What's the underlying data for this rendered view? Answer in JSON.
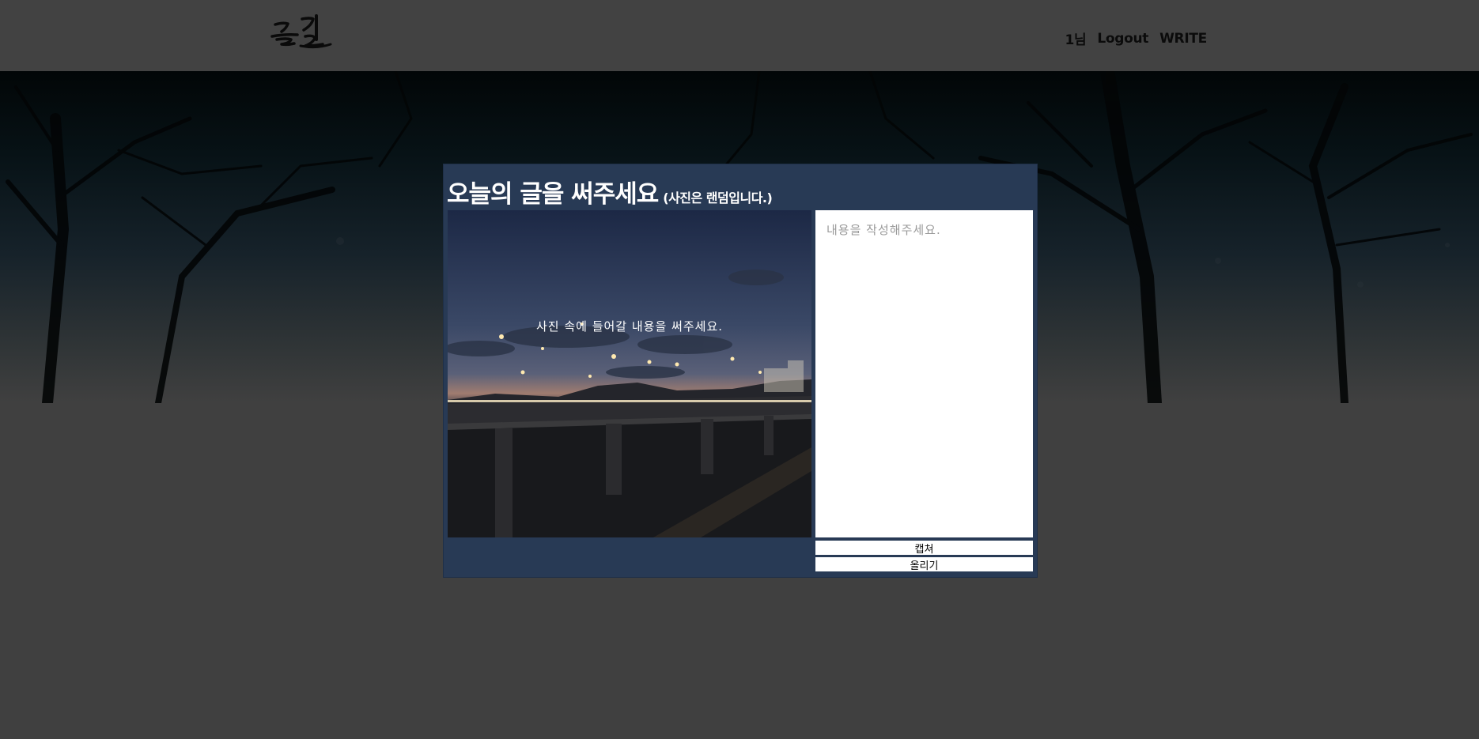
{
  "header": {
    "logo_text": "글길",
    "user_label": "1님",
    "logout_label": "Logout",
    "write_label": "WRITE"
  },
  "editor": {
    "title": "오늘의 글을 써주세요",
    "subtitle": "(사진은 랜덤입니다.)",
    "photo_caption": "사진 속에 들어갈 내용을 써주세요.",
    "content_placeholder": "내용을 작성해주세요.",
    "capture_label": "캡쳐",
    "upload_label": "올리기"
  },
  "colors": {
    "page_bg": "#404040",
    "header_bg": "#424242",
    "panel_bg": "#283a55"
  }
}
